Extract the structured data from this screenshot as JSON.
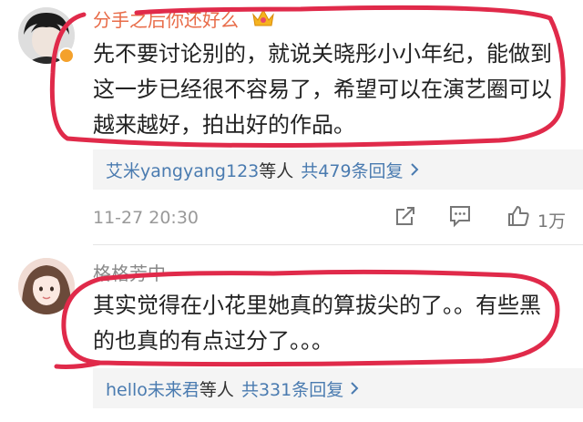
{
  "comments": [
    {
      "username": "分手之后你还好么",
      "text_lines": [
        "先不要讨论别的，就说关晓彤小小年纪，能做到",
        "这一步已经很不容易了，希望可以在演艺圈可以",
        "越来越好，拍出好的作品。"
      ],
      "replies": {
        "users": "艾米yangyang123",
        "suffix": "等人",
        "count": "共479条回复"
      },
      "timestamp": "11-27 20:30",
      "likes": "1万"
    },
    {
      "username": "格格芳中",
      "text_lines": [
        "其实觉得在小花里她真的算拔尖的了。。有些黑",
        "的也真的有点过分了。。。"
      ],
      "replies": {
        "users": "hello未来君",
        "suffix": "等人",
        "count": "共331条回复"
      }
    }
  ],
  "icons": {
    "crown": "crown-badge-icon",
    "verified": "verified-badge-icon",
    "share": "share-icon",
    "comment": "comment-icon",
    "like": "thumbs-up-icon",
    "chevron": "chevron-right-icon"
  },
  "colors": {
    "username_highlight": "#e86b48",
    "link_blue": "#4a7bb0",
    "annotation_red": "#e02a4a",
    "reply_bg": "#f4f4f4"
  }
}
